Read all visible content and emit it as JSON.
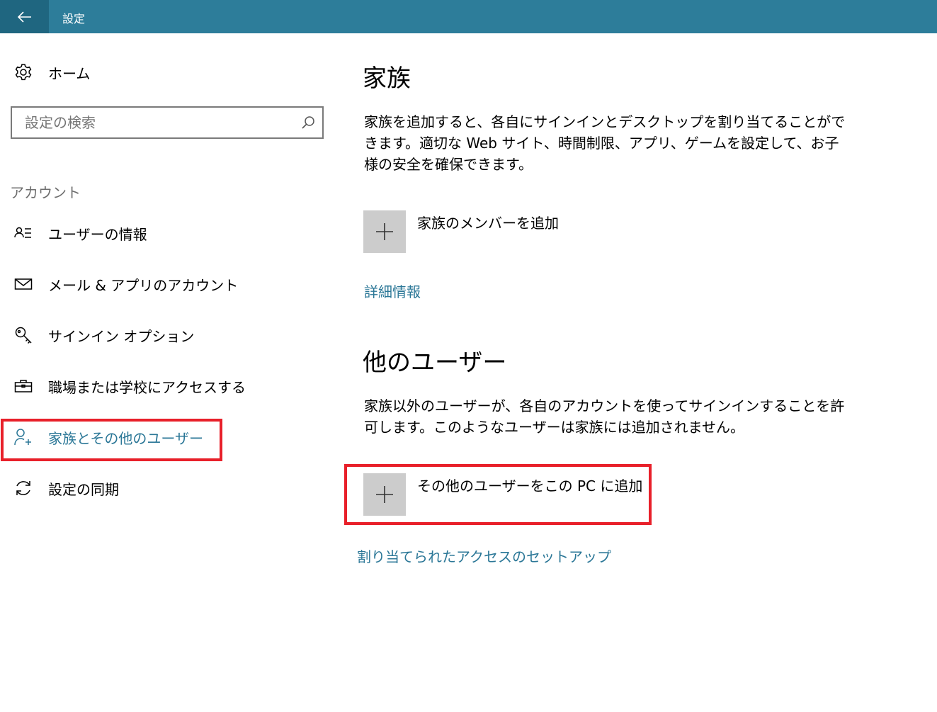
{
  "window": {
    "title": "設定"
  },
  "sidebar": {
    "home_label": "ホーム",
    "search_placeholder": "設定の検索",
    "section_header": "アカウント",
    "items": [
      {
        "label": "ユーザーの情報",
        "icon": "user-info-icon"
      },
      {
        "label": "メール & アプリのアカウント",
        "icon": "mail-icon"
      },
      {
        "label": "サインイン オプション",
        "icon": "key-icon"
      },
      {
        "label": "職場または学校にアクセスする",
        "icon": "briefcase-icon"
      },
      {
        "label": "家族とその他のユーザー",
        "icon": "add-person-icon",
        "active": true
      },
      {
        "label": "設定の同期",
        "icon": "sync-icon"
      }
    ]
  },
  "main": {
    "family": {
      "heading": "家族",
      "description": "家族を追加すると、各自にサインインとデスクトップを割り当てることができます。適切な Web サイト、時間制限、アプリ、ゲームを設定して、お子様の安全を確保できます。",
      "add_label": "家族のメンバーを追加",
      "more_info_link": "詳細情報"
    },
    "other_users": {
      "heading": "他のユーザー",
      "description": "家族以外のユーザーが、各自のアカウントを使ってサインインすることを許可します。このようなユーザーは家族には追加されません。",
      "add_label": "その他のユーザーをこの PC に追加",
      "assigned_access_link": "割り当てられたアクセスのセットアップ"
    }
  },
  "colors": {
    "titlebar": "#2d7d9a",
    "back_button": "#1f6680",
    "accent": "#2b7797",
    "highlight": "#e8202a",
    "tile": "#cccccc"
  }
}
